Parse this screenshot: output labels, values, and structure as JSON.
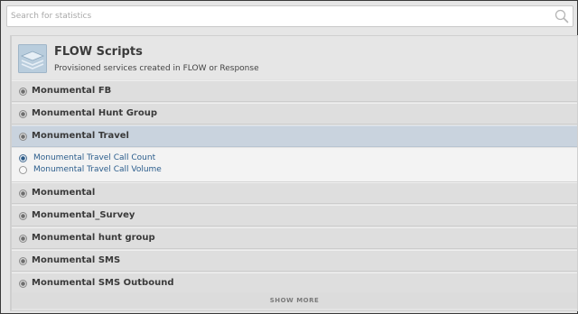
{
  "search": {
    "placeholder": "Search for statistics",
    "value": ""
  },
  "header": {
    "title": "FLOW Scripts",
    "subtitle": "Provisioned services created in FLOW or Response",
    "icon": "folder-layers-icon"
  },
  "rows": [
    {
      "label": "Monumental FB",
      "expanded": false
    },
    {
      "label": "Monumental Hunt Group",
      "expanded": false
    },
    {
      "label": "Monumental Travel",
      "expanded": true
    },
    {
      "label": "Monumental",
      "expanded": false
    },
    {
      "label": "Monumental_Survey",
      "expanded": false
    },
    {
      "label": "Monumental hunt group",
      "expanded": false
    },
    {
      "label": "Monumental SMS",
      "expanded": false
    },
    {
      "label": "Monumental SMS Outbound",
      "expanded": false
    }
  ],
  "expanded_items": [
    {
      "label": "Monumental Travel Call Count",
      "checked": true
    },
    {
      "label": "Monumental Travel Call Volume",
      "checked": false
    }
  ],
  "show_more_label": "SHOW MORE",
  "colors": {
    "active_row": "#c9d3de",
    "link": "#2b5d8c",
    "row_bg": "#dedede"
  }
}
